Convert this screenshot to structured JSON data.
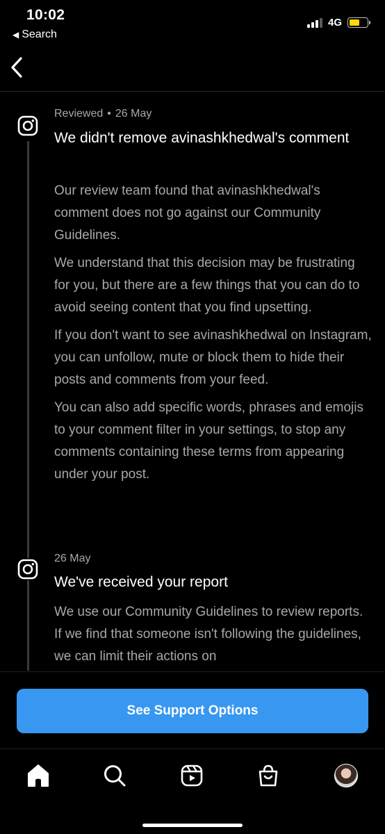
{
  "status_bar": {
    "time": "10:02",
    "back_app": "Search",
    "network": "4G",
    "signal_bars": 3,
    "battery_level": 0.6,
    "battery_color": "#ffd60a"
  },
  "nav": {
    "back_icon": "chevron-left-icon"
  },
  "timeline": [
    {
      "status": "Reviewed",
      "date": "26 May",
      "title": "We didn't remove avinashkhedwal's comment",
      "paragraphs": [
        "Our review team found that avinashkhedwal's comment does not go against our Community Guidelines.",
        "We understand that this decision may be frustrating for you, but there are a few things that you can do to avoid seeing content that you find upsetting.",
        "If you don't want to see avinashkhedwal on Instagram, you can unfollow, mute or block them to hide their posts and comments from your feed.",
        "You can also add specific words, phrases and emojis to your comment filter in your settings, to stop any comments containing these terms from appearing under your post."
      ]
    },
    {
      "date": "26 May",
      "title": "We've received your report",
      "paragraphs": [
        "We use our Community Guidelines to review reports. If we find that someone isn't following the guidelines, we can limit their actions on"
      ]
    }
  ],
  "support": {
    "button_label": "See Support Options",
    "button_color": "#3897f0"
  },
  "tab_bar": {
    "items": [
      "home-icon",
      "search-icon",
      "reels-icon",
      "shop-icon",
      "profile-avatar"
    ]
  }
}
